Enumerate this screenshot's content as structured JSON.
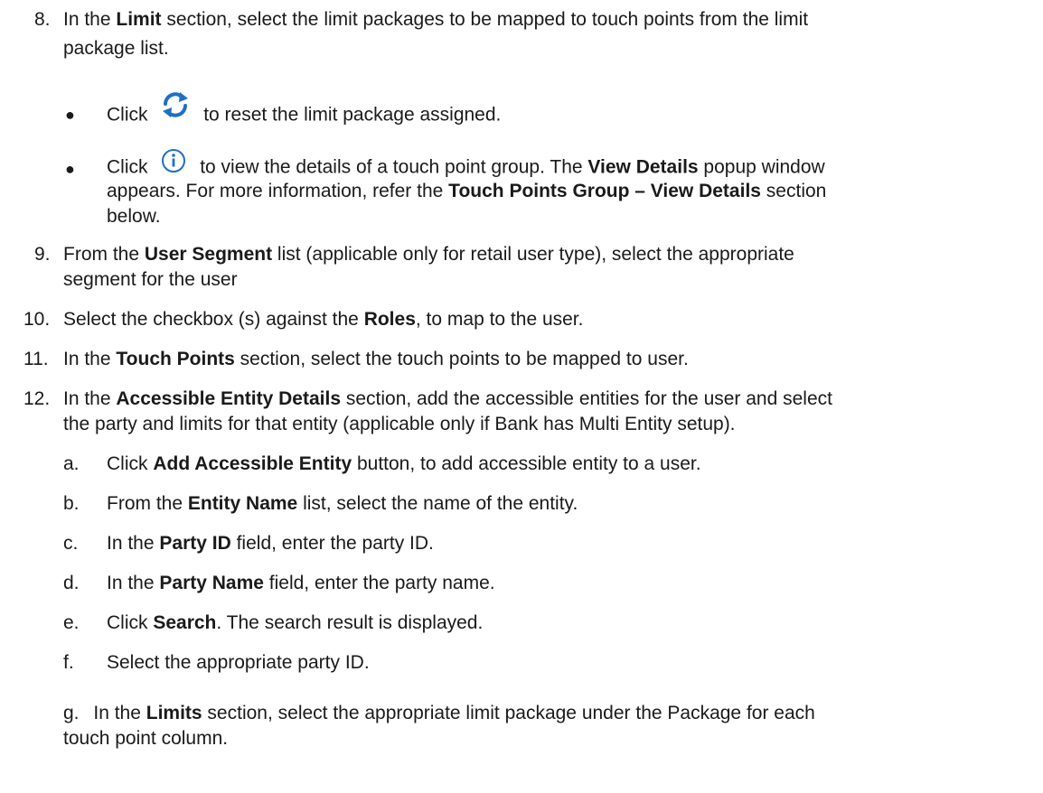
{
  "step8": {
    "num": "8.",
    "l1_a": "In the ",
    "l1_b": "Limit",
    "l1_c": " section, select the limit packages to be mapped to touch points from the limit",
    "l2": "package list.",
    "bullet1_a": "Click",
    "bullet1_b": "to reset the limit package assigned.",
    "bullet2_a": "Click",
    "bullet2_b": "to view the details of a touch point group. The ",
    "bullet2_c": "View Details",
    "bullet2_d": " popup window",
    "bullet2_l2_a": "appears. For more information, refer the ",
    "bullet2_l2_b": "Touch Points Group – View Details",
    "bullet2_l2_c": " section",
    "bullet2_l3": "below.",
    "icons": [
      "refresh-icon",
      "info-icon"
    ]
  },
  "step9": {
    "num": "9.",
    "l1_a": "From the ",
    "l1_b": "User Segment",
    "l1_c": " list (applicable only for retail user type), select the appropriate",
    "l2": "segment for the user"
  },
  "step10": {
    "num": "10.",
    "a": "Select the checkbox (s) against the ",
    "b": "Roles",
    "c": ", to map to the user."
  },
  "step11": {
    "num": "11.",
    "a": "In the ",
    "b": "Touch Points",
    "c": " section, select the touch points to be mapped to user."
  },
  "step12": {
    "num": "12.",
    "l1_a": "In the ",
    "l1_b": "Accessible Entity Details",
    "l1_c": " section, add the accessible entities for the user and select",
    "l2": "the party and limits for that entity (applicable only if Bank has Multi Entity setup).",
    "subs": {
      "a": {
        "letter": "a.",
        "p1": "Click ",
        "b": "Add Accessible Entity",
        "p2": " button, to add accessible entity to a user."
      },
      "b": {
        "letter": "b.",
        "p1": "From the ",
        "b": "Entity Name",
        "p2": " list, select the name of the entity."
      },
      "c": {
        "letter": "c.",
        "p1": "In the ",
        "b": "Party ID",
        "p2": " field, enter the party ID."
      },
      "d": {
        "letter": "d.",
        "p1": "In the ",
        "b": "Party Name",
        "p2": " field, enter the party name."
      },
      "e": {
        "letter": "e.",
        "p1": "Click ",
        "b": "Search",
        "p2": ". The search result is displayed."
      },
      "f": {
        "letter": "f.",
        "p1": "Select the appropriate party ID."
      },
      "g": {
        "letter": "g.",
        "p1": "In the ",
        "b": "Limits",
        "p2": " section, select the appropriate limit package under the Package for each",
        "l2": "touch point column."
      }
    }
  },
  "colors": {
    "text": "#1a1a1a",
    "icon_blue": "#1f6fc5"
  }
}
